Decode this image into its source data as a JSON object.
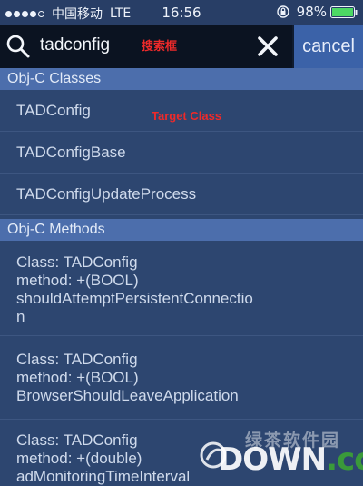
{
  "status_bar": {
    "carrier": "中国移动",
    "network": "LTE",
    "time": "16:56",
    "battery_percent": "98%",
    "signal_dots": 4,
    "signal_total": 5,
    "battery_color": "#4cd964"
  },
  "search": {
    "value": "tadconfig",
    "annotation": "搜索框",
    "cancel_label": "cancel"
  },
  "sections": {
    "classes_header": "Obj-C Classes",
    "methods_header": "Obj-C Methods"
  },
  "classes": [
    "TADConfig",
    "TADConfigBase",
    "TADConfigUpdateProcess"
  ],
  "target_annotation": "Target Class",
  "methods": [
    {
      "lines": [
        "Class: TADConfig",
        "method: +(BOOL)",
        "shouldAttemptPersistentConnectio",
        "n"
      ]
    },
    {
      "lines": [
        "Class: TADConfig",
        "method: +(BOOL)",
        "BrowserShouldLeaveApplication"
      ]
    },
    {
      "lines": [
        "Class: TADConfig",
        "method: +(double)",
        "adMonitoringTimeInterval"
      ]
    }
  ],
  "watermark": {
    "top_text": "绿茶软件园",
    "main_text": "DOWN",
    "suffix": ".cc"
  },
  "colors": {
    "annotation_red": "#ee2a2a",
    "cancel_bg": "#3b62a8",
    "section_bg": "#4c6eac",
    "list_bg": "#2d4670"
  }
}
